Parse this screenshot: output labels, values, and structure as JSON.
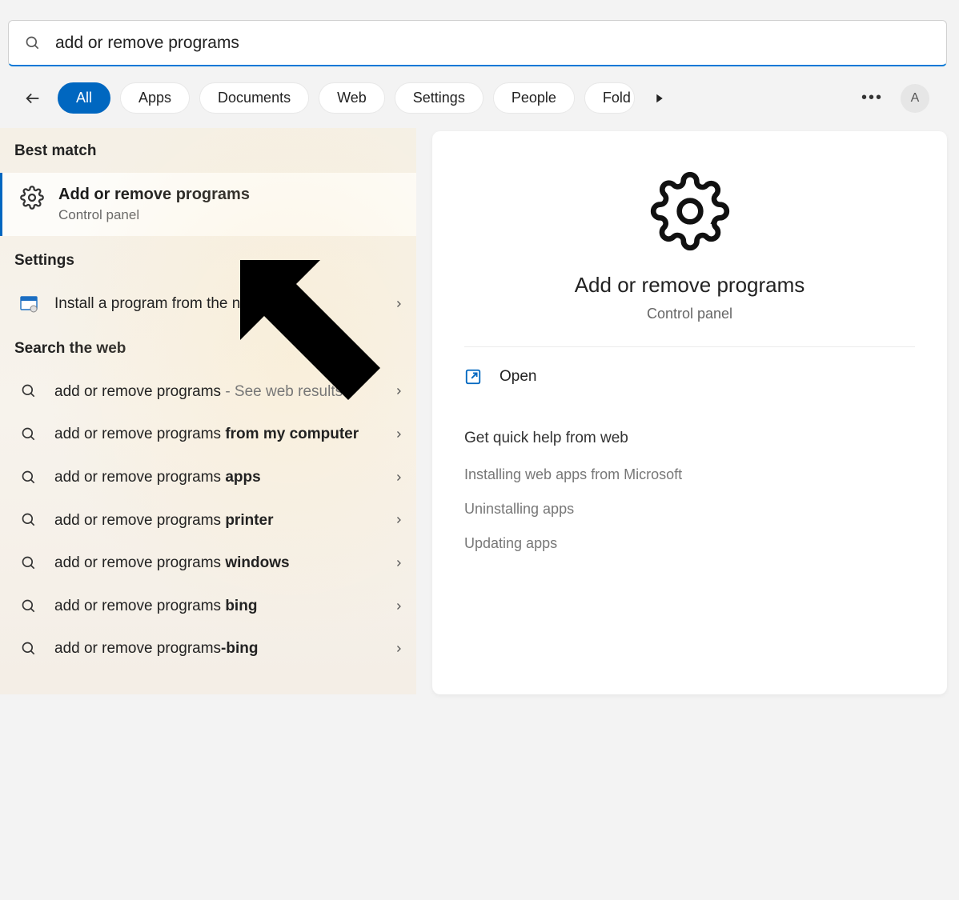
{
  "search": {
    "query": "add or remove programs"
  },
  "filters": {
    "items": [
      "All",
      "Apps",
      "Documents",
      "Web",
      "Settings",
      "People",
      "Fold"
    ],
    "active_index": 0
  },
  "avatar_initial": "A",
  "left": {
    "best_match_header": "Best match",
    "best_match": {
      "title": "Add or remove programs",
      "subtitle": "Control panel"
    },
    "settings_header": "Settings",
    "settings_item": "Install a program from the network",
    "web_header": "Search the web",
    "web_items": [
      {
        "prefix": "add or remove programs",
        "suffix_muted": " - See web results",
        "bold": ""
      },
      {
        "prefix": "add or remove programs ",
        "bold": "from my computer"
      },
      {
        "prefix": "add or remove programs ",
        "bold": "apps"
      },
      {
        "prefix": "add or remove programs ",
        "bold": "printer"
      },
      {
        "prefix": "add or remove programs ",
        "bold": "windows"
      },
      {
        "prefix": "add or remove programs ",
        "bold": "bing"
      },
      {
        "prefix": "add or remove programs",
        "bold": "-bing"
      }
    ]
  },
  "right": {
    "title": "Add or remove programs",
    "subtitle": "Control panel",
    "open_label": "Open",
    "help_header": "Get quick help from web",
    "help_links": [
      "Installing web apps from Microsoft",
      "Uninstalling apps",
      "Updating apps"
    ]
  }
}
